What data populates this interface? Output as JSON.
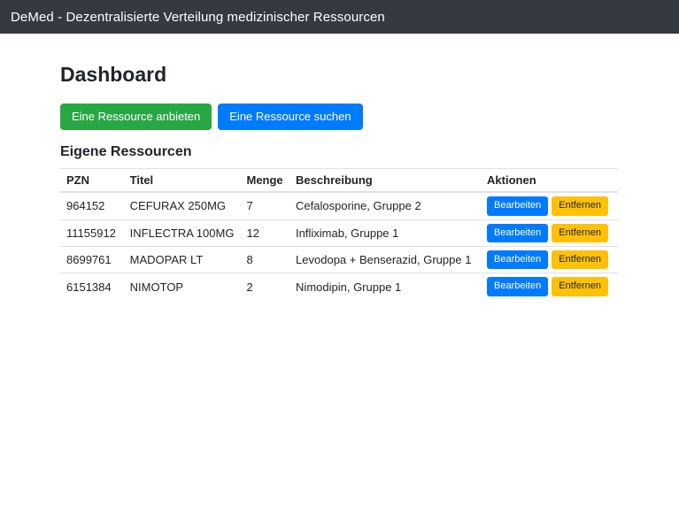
{
  "navbar": {
    "brand": "DeMed - Dezentralisierte Verteilung medizinischer Ressourcen"
  },
  "page": {
    "title": "Dashboard"
  },
  "toolbar": {
    "offer_label": "Eine Ressource anbieten",
    "search_label": "Eine Ressource suchen"
  },
  "resources": {
    "heading": "Eigene Ressourcen",
    "columns": [
      "PZN",
      "Titel",
      "Menge",
      "Beschreibung",
      "Aktionen"
    ],
    "rows": [
      {
        "pzn": "964152",
        "titel": "CEFURAX 250MG",
        "menge": "7",
        "beschreibung": "Cefalosporine, Gruppe 2"
      },
      {
        "pzn": "11155912",
        "titel": "INFLECTRA 100MG",
        "menge": "12",
        "beschreibung": "Infliximab, Gruppe 1"
      },
      {
        "pzn": "8699761",
        "titel": "MADOPAR LT",
        "menge": "8",
        "beschreibung": "Levodopa + Benserazid, Gruppe 1"
      },
      {
        "pzn": "6151384",
        "titel": "NIMOTOP",
        "menge": "2",
        "beschreibung": "Nimodipin, Gruppe 1"
      }
    ],
    "row_actions": {
      "edit_label": "Bearbeiten",
      "remove_label": "Entfernen"
    }
  },
  "colors": {
    "navbar_bg": "#343a40",
    "navbar_text": "#ffffff",
    "primary": "#007bff",
    "success": "#28a745",
    "warning": "#ffc107",
    "table_border": "#dee2e6",
    "text": "#212529"
  }
}
